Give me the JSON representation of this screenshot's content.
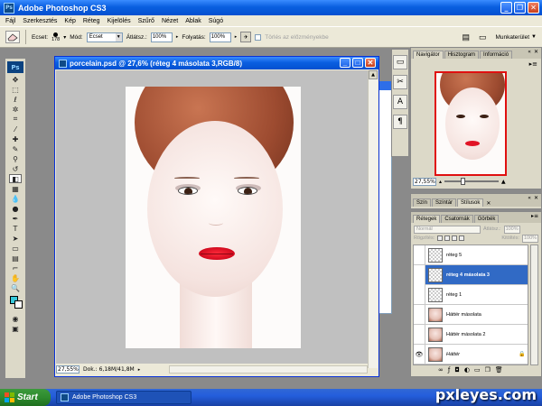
{
  "app": {
    "title": "Adobe Photoshop CS3",
    "logo": "Ps"
  },
  "menu": [
    "Fájl",
    "Szerkesztés",
    "Kép",
    "Réteg",
    "Kijelölés",
    "Szűrő",
    "Nézet",
    "Ablak",
    "Súgó"
  ],
  "options": {
    "tool_label": "Ecset:",
    "brush_size": "178",
    "mode_label": "Mód:",
    "mode_value": "Ecset",
    "opacity_label": "Átlátsz.:",
    "opacity_value": "100%",
    "flow_label": "Folyatás:",
    "flow_value": "100%",
    "history_checkbox_label": "Törlés az előzményekbe",
    "workspace_label": "Munkaterület"
  },
  "document": {
    "title": "porcelain.psd @ 27,6% (réteg 4 másolata 3,RGB/8)",
    "zoom": "27,55%",
    "doc_info": "Dok.: 6,18M/41,8M"
  },
  "navigator": {
    "tabs": [
      "Navigátor",
      "Hisztogram",
      "Információ"
    ],
    "zoom": "27,55%"
  },
  "history_panel": {
    "tabs": [
      "Szín",
      "Színtár",
      "Stílusok"
    ]
  },
  "layers_panel": {
    "tabs": [
      "Rétegek",
      "Csatornák",
      "Görbék"
    ],
    "blend_mode": "Normál",
    "opacity_label": "Átlátsz.:",
    "opacity_value": "100%",
    "lock_label": "Rögzítés:",
    "fill_label": "Kitöltés:",
    "fill_value": "100%",
    "layers": [
      {
        "name": "réteg 5",
        "thumb": "transparent",
        "visible": false,
        "selected": false
      },
      {
        "name": "réteg 4 másolata 3",
        "thumb": "transparent",
        "visible": false,
        "selected": true
      },
      {
        "name": "réteg 1",
        "thumb": "transparent",
        "visible": false,
        "selected": false
      },
      {
        "name": "Háttér másolata",
        "thumb": "face",
        "visible": false,
        "selected": false
      },
      {
        "name": "Háttér másolata 2",
        "thumb": "face",
        "visible": false,
        "selected": false
      },
      {
        "name": "Háttér",
        "thumb": "face",
        "visible": true,
        "selected": false,
        "locked": true
      }
    ]
  },
  "taskbar": {
    "start_label": "Start",
    "task_label": "Adobe Photoshop CS3"
  },
  "watermark": "pxleyes.com",
  "colors": {
    "foreground": "#37c8d8",
    "background": "#ffffff",
    "selection": "#316ac5"
  }
}
